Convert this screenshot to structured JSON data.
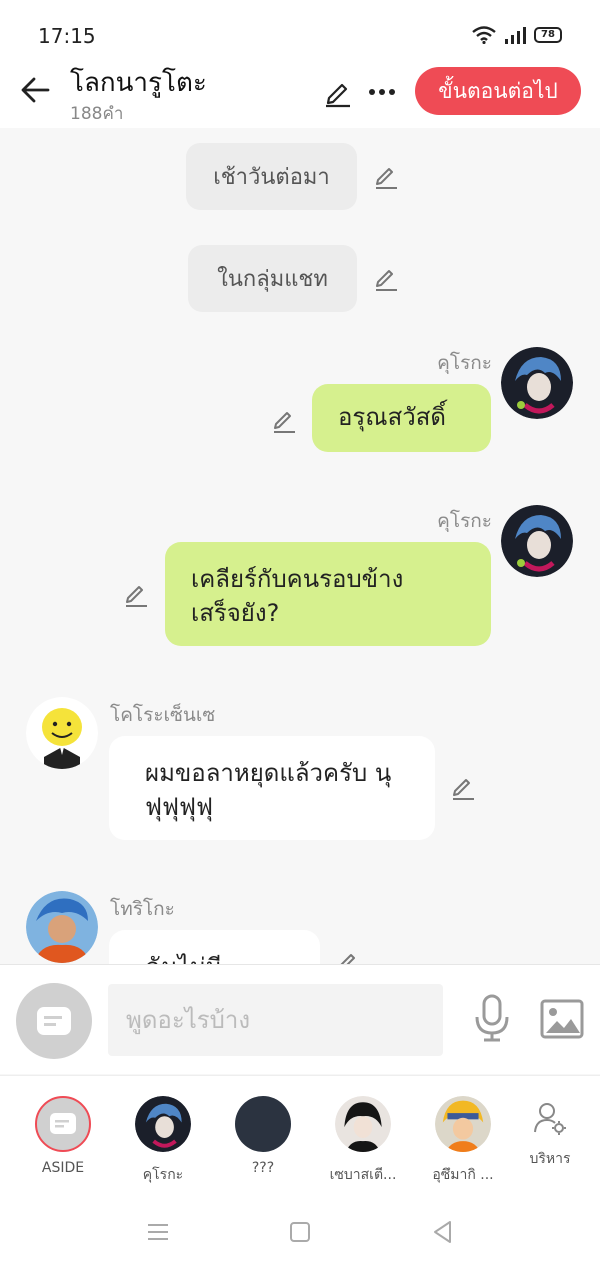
{
  "status": {
    "time": "17:15",
    "battery": "78"
  },
  "header": {
    "title": "โลกนารูโตะ",
    "word_count": "188คำ",
    "next_label": "ขั้นตอนต่อไป"
  },
  "messages": {
    "narr1": "เช้าวันต่อมา",
    "narr2": "ในกลุ่มแชท",
    "m1": {
      "sender": "คุโรกะ",
      "text": "อรุณสวัสดิ์"
    },
    "m2": {
      "sender": "คุโรกะ",
      "line1": "เคลียร์กับคนรอบข้าง",
      "line2": "เสร็จยัง?"
    },
    "m3": {
      "sender": "โคโระเซ็นเซ",
      "line1": "ผมขอลาหยุดแล้วครับ นุ",
      "line2": "ฟุฟุฟุฟุ"
    },
    "m4": {
      "sender": "โทริโกะ",
      "text": "ฉันไม่มีปัญหา"
    }
  },
  "input": {
    "placeholder": "พูดอะไรบ้าง"
  },
  "characters": [
    {
      "name": "ASIDE"
    },
    {
      "name": "คุโรกะ"
    },
    {
      "name": "???"
    },
    {
      "name": "เซบาสเตี..."
    },
    {
      "name": "อุซึมากิ ..."
    }
  ],
  "manage_label": "บริหาร",
  "colors": {
    "accent": "#ef4b55",
    "bubble_self": "#d6f08e"
  }
}
